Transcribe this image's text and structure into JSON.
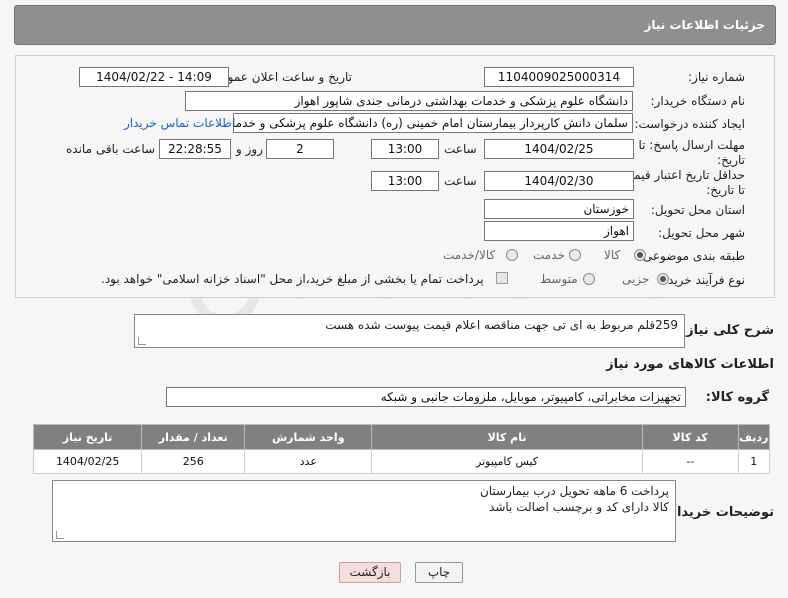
{
  "header": {
    "title": "جزئیات اطلاعات نیاز"
  },
  "fields": {
    "need_number": {
      "label": "شماره نیاز:",
      "value": "1104009025000314"
    },
    "announce_datetime": {
      "label": "تاریخ و ساعت اعلان عمومی:",
      "value": "1404/02/22 - 14:09"
    },
    "buyer_org": {
      "label": "نام دستگاه خریدار:",
      "value": "دانشگاه علوم پزشکی و خدمات بهداشتی درمانی جندی شاپور اهواز"
    },
    "requester": {
      "label": "ایجاد کننده درخواست:",
      "value": "سلمان دانش کارپرداز بیمارستان امام خمینی (ره) دانشگاه علوم پزشکی و خدما",
      "contact_link": "اطلاعات تماس خریدار"
    },
    "reply_deadline": {
      "label": "مهلت ارسال پاسخ: تا تاریخ:",
      "date": "1404/02/25",
      "time_label": "ساعت",
      "time": "13:00",
      "days": "2",
      "days_label": "روز و",
      "remaining": "22:28:55",
      "remaining_label": "ساعت باقی مانده"
    },
    "price_validity": {
      "label": "حداقل تاریخ اعتبار قیمت: تا تاریخ:",
      "date": "1404/02/30",
      "time_label": "ساعت",
      "time": "13:00"
    },
    "province": {
      "label": "استان محل تحویل:",
      "value": "خوزستان"
    },
    "city": {
      "label": "شهر محل تحویل:",
      "value": "اهواز"
    },
    "category": {
      "label": "طبقه بندی موضوعی:",
      "options": [
        "کالا",
        "خدمت",
        "کالا/خدمت"
      ],
      "selected": "کالا"
    },
    "purchase_type": {
      "label": "نوع فرآیند خرید :",
      "options": [
        "جزیی",
        "متوسط"
      ],
      "selected": "جزیی",
      "payment_note": "پرداخت تمام یا بخشی از مبلغ خرید،از محل \"اسناد خزانه اسلامی\" خواهد بود."
    }
  },
  "description": {
    "label": "شرح کلی نیاز:",
    "value": "259قلم مربوط به ای تی جهت مناقصه اعلام قیمت پیوست شده هست"
  },
  "goods_section": {
    "title": "اطلاعات کالاهای مورد نیاز"
  },
  "goods_group": {
    "label": "گروه کالا:",
    "value": "تجهیزات مخابراتی، کامپیوتر، موبایل، ملزومات جانبی و شبکه"
  },
  "table": {
    "headers": [
      "ردیف",
      "کد کالا",
      "نام کالا",
      "واحد شمارش",
      "تعداد / مقدار",
      "تاریخ نیاز"
    ],
    "rows": [
      [
        "1",
        "--",
        "کیس کامپیوتر",
        "عدد",
        "256",
        "1404/02/25"
      ]
    ]
  },
  "buyer_notes": {
    "label": "توضیحات خریدار:",
    "lines": [
      "پرداخت 6 ماهه تحویل درب بیمارستان",
      "کالا دارای کد و برچسب اصالت باشد"
    ]
  },
  "buttons": {
    "print": "چاپ",
    "back": "بازگشت"
  },
  "colors": {
    "header_bg": "#8f8f8f",
    "table_header_bg": "#808080",
    "link": "#1a66c8",
    "back_button_bg": "#f7dede"
  }
}
